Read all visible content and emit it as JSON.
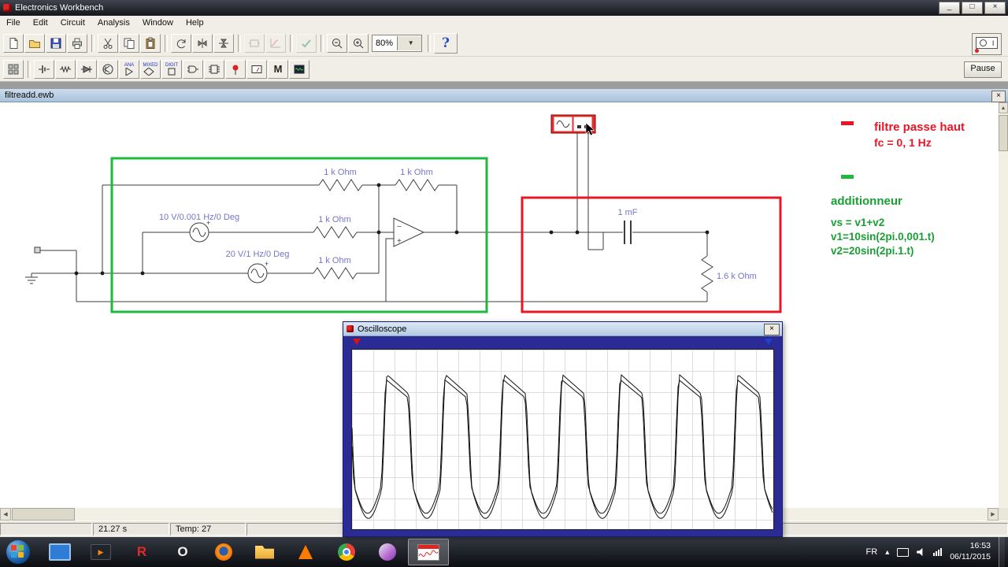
{
  "window": {
    "title": "Electronics Workbench",
    "controls": {
      "minimize": "_",
      "maximize": "□",
      "close": "×"
    }
  },
  "menu": {
    "items": [
      "File",
      "Edit",
      "Circuit",
      "Analysis",
      "Window",
      "Help"
    ]
  },
  "toolbar": {
    "zoom_value": "80%",
    "help_label": "?",
    "pause_label": "Pause"
  },
  "palette": {
    "ana": "ANA",
    "mixed": "MIXED",
    "digit": "DIGIT",
    "misc": "M"
  },
  "document": {
    "tab": "filtreadd.ewb",
    "close": "×"
  },
  "circuit": {
    "labels": {
      "r1": "1 k Ohm",
      "r2": "1 k Ohm",
      "r3": "1 k Ohm",
      "r4": "1 k Ohm",
      "src1": "10 V/0.001 Hz/0 Deg",
      "src2": "20 V/1 Hz/0 Deg",
      "cap": "1 mF",
      "r_load": "1.6 k Ohm"
    },
    "annotations": {
      "red_title": "filtre passe haut",
      "red_sub": "fc = 0,   1 Hz",
      "green_title": "additionneur",
      "green_l1": "vs = v1+v2",
      "green_l2": "v1=10sin(2pi.0,001.t)",
      "green_l3": "v2=20sin(2pi.1.t)"
    },
    "colors": {
      "box_green": "#1fba3c",
      "box_red": "#ea1626",
      "label_blue": "#7575c8",
      "wire": "#3c3c3c"
    }
  },
  "oscilloscope": {
    "title": "Oscilloscope",
    "close": "×",
    "waveform": {
      "cycles": 7.2,
      "trace2_scale": 0.93,
      "trace2_phase": 0.013
    }
  },
  "statusbar": {
    "sim_time": "21.27 s",
    "temp": "Temp:  27"
  },
  "taskbar": {
    "icon_letters": {
      "realplayer": "R",
      "opera": "O"
    },
    "tray": {
      "language": "FR",
      "expand": "▴",
      "time": "16:53",
      "date": "06/11/2015"
    }
  }
}
